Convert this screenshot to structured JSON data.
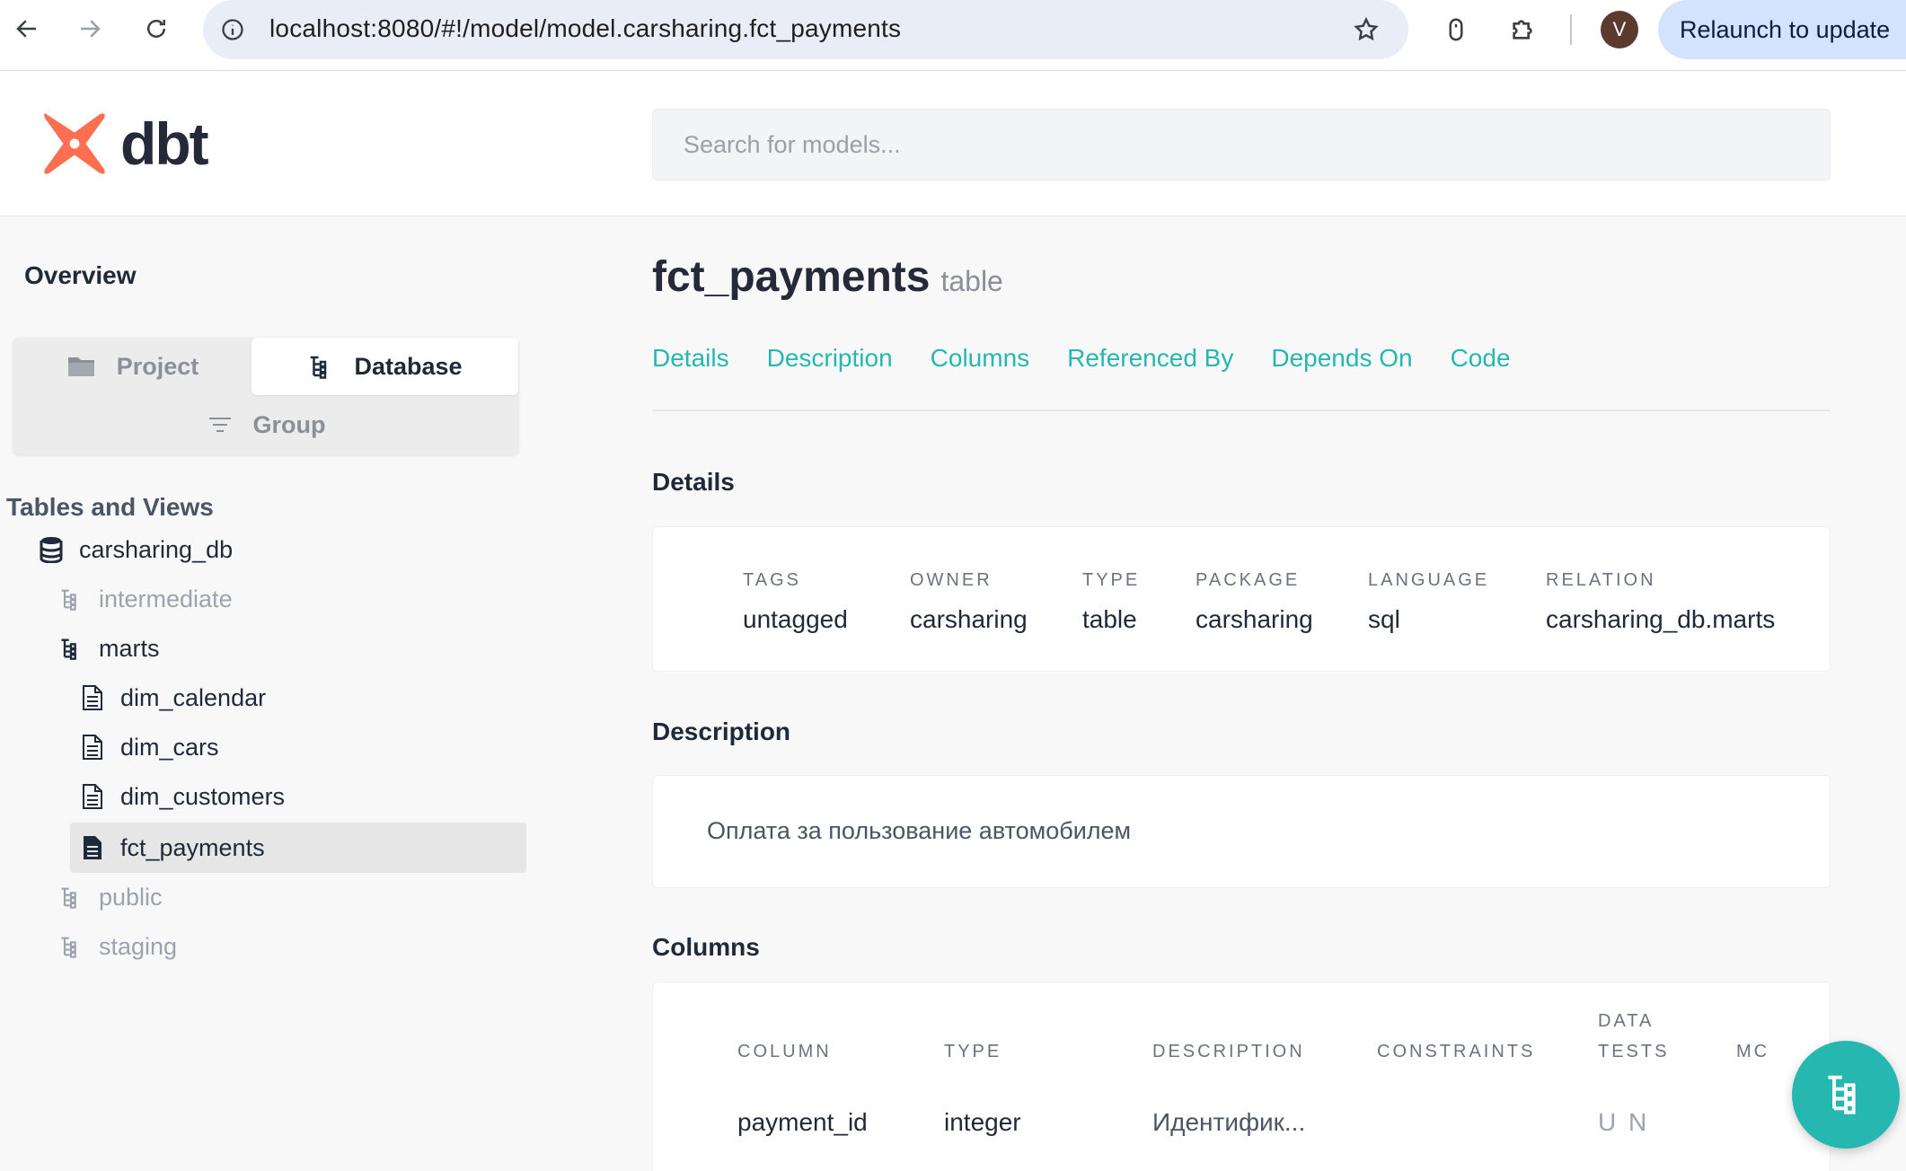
{
  "browser": {
    "url": "localhost:8080/#!/model/model.carsharing.fct_payments",
    "avatar_letter": "V",
    "relaunch_label": "Relaunch to update"
  },
  "header": {
    "logo_text": "dbt",
    "search_placeholder": "Search for models..."
  },
  "sidebar": {
    "overview_label": "Overview",
    "switch": {
      "project_label": "Project",
      "database_label": "Database",
      "group_label": "Group",
      "active": "Database"
    },
    "section_title": "Tables and Views",
    "tree": {
      "database": "carsharing_db",
      "schemas": {
        "intermediate": "intermediate",
        "marts": "marts",
        "public": "public",
        "staging": "staging"
      },
      "models": [
        "dim_calendar",
        "dim_cars",
        "dim_customers",
        "fct_payments"
      ],
      "selected": "fct_payments"
    }
  },
  "main": {
    "title": "fct_payments",
    "kind": "table",
    "tabs": [
      "Details",
      "Description",
      "Columns",
      "Referenced By",
      "Depends On",
      "Code"
    ],
    "details_heading": "Details",
    "details": [
      {
        "label": "TAGS",
        "value": "untagged"
      },
      {
        "label": "OWNER",
        "value": "carsharing"
      },
      {
        "label": "TYPE",
        "value": "table"
      },
      {
        "label": "PACKAGE",
        "value": "carsharing"
      },
      {
        "label": "LANGUAGE",
        "value": "sql"
      },
      {
        "label": "RELATION",
        "value": "carsharing_db.marts"
      }
    ],
    "description_heading": "Description",
    "description_text": "Оплата за пользование автомобилем",
    "columns_heading": "Columns",
    "columns_table": {
      "headers": {
        "column": "COLUMN",
        "type": "TYPE",
        "description": "DESCRIPTION",
        "constraints": "CONSTRAINTS",
        "data_tests_line1": "DATA",
        "data_tests_line2": "TESTS",
        "more": "MC"
      },
      "rows": [
        {
          "column": "payment_id",
          "type": "integer",
          "description": "Идентифик...",
          "constraints": "",
          "data_tests": "U N"
        }
      ]
    }
  },
  "colors": {
    "accent": "#26b8b0",
    "logo": "#fe6f51",
    "text_dark": "#262a38"
  }
}
